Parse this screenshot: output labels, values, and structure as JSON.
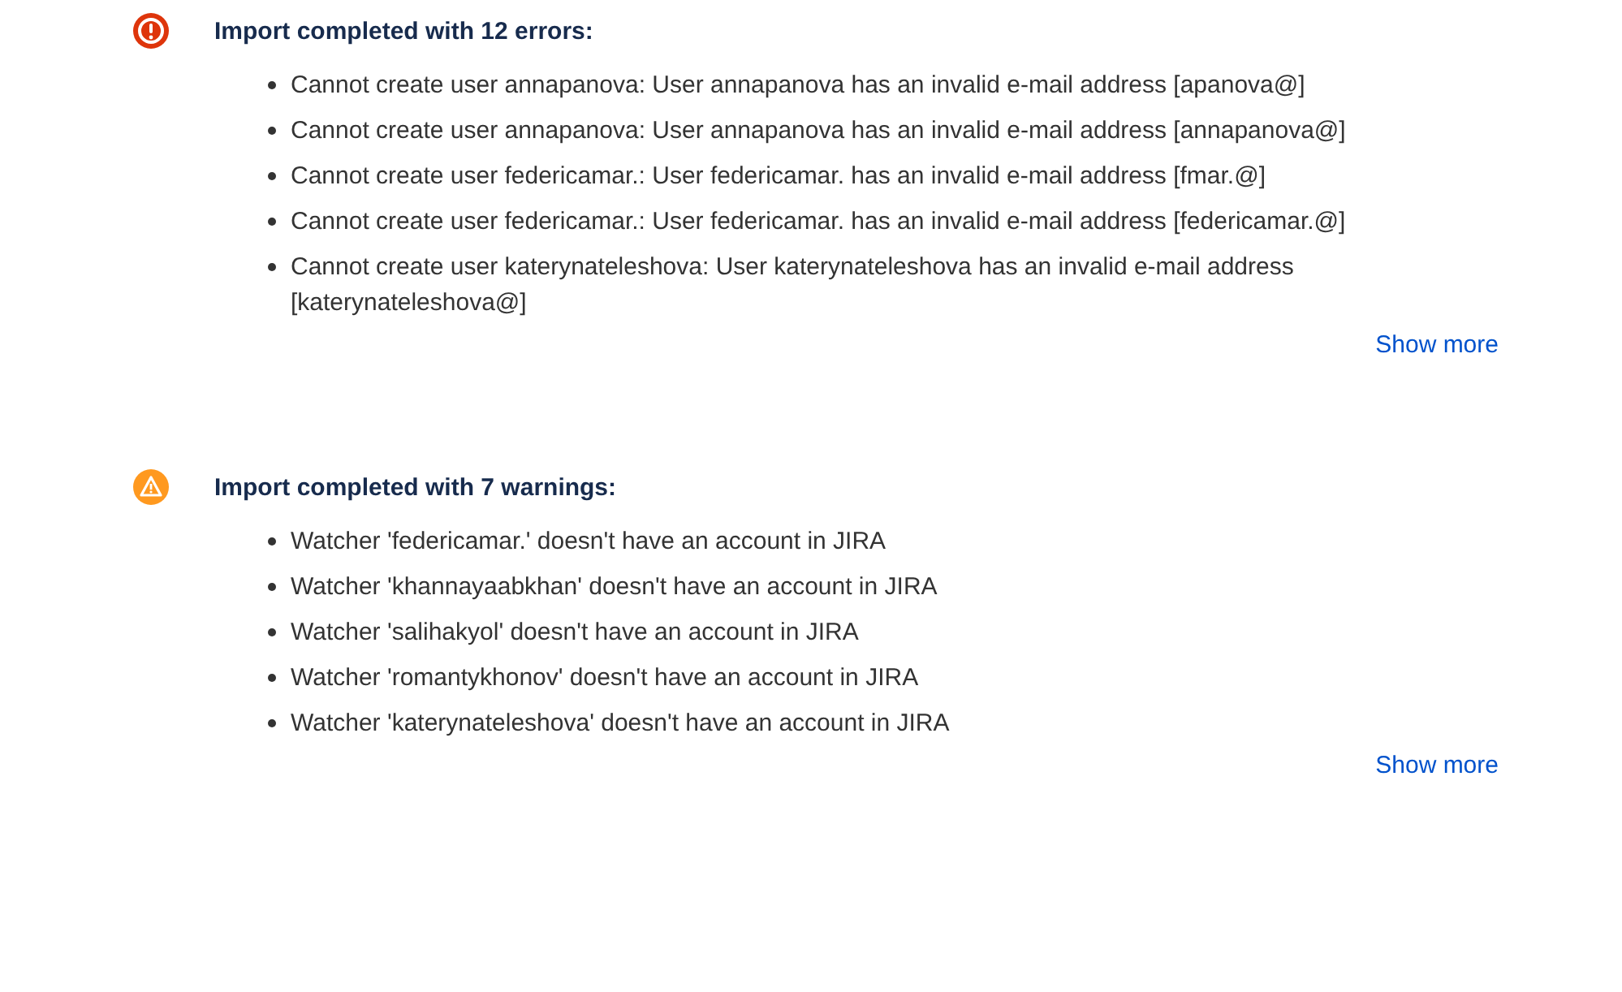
{
  "sections": [
    {
      "kind": "error",
      "title": "Import completed with 12 errors:",
      "items": [
        "Cannot create user annapanova: User annapanova has an invalid e-mail address [apanova@]",
        "Cannot create user annapanova: User annapanova has an invalid e-mail address [annapanova@]",
        "Cannot create user federicamar.: User federicamar. has an invalid e-mail address [fmar.@]",
        "Cannot create user federicamar.: User federicamar. has an invalid e-mail address [federicamar.@]",
        "Cannot create user katerynateleshova: User katerynateleshova has an invalid e-mail address [katerynateleshova@]"
      ],
      "link": "Show more"
    },
    {
      "kind": "warning",
      "title": "Import completed with 7 warnings:",
      "items": [
        "Watcher 'federicamar.' doesn't have an account in JIRA",
        "Watcher 'khannayaabkhan' doesn't have an account in JIRA",
        "Watcher 'salihakyol' doesn't have an account in JIRA",
        "Watcher 'romantykhonov' doesn't have an account in JIRA",
        "Watcher 'katerynateleshova' doesn't have an account in JIRA"
      ],
      "link": "Show more"
    }
  ]
}
